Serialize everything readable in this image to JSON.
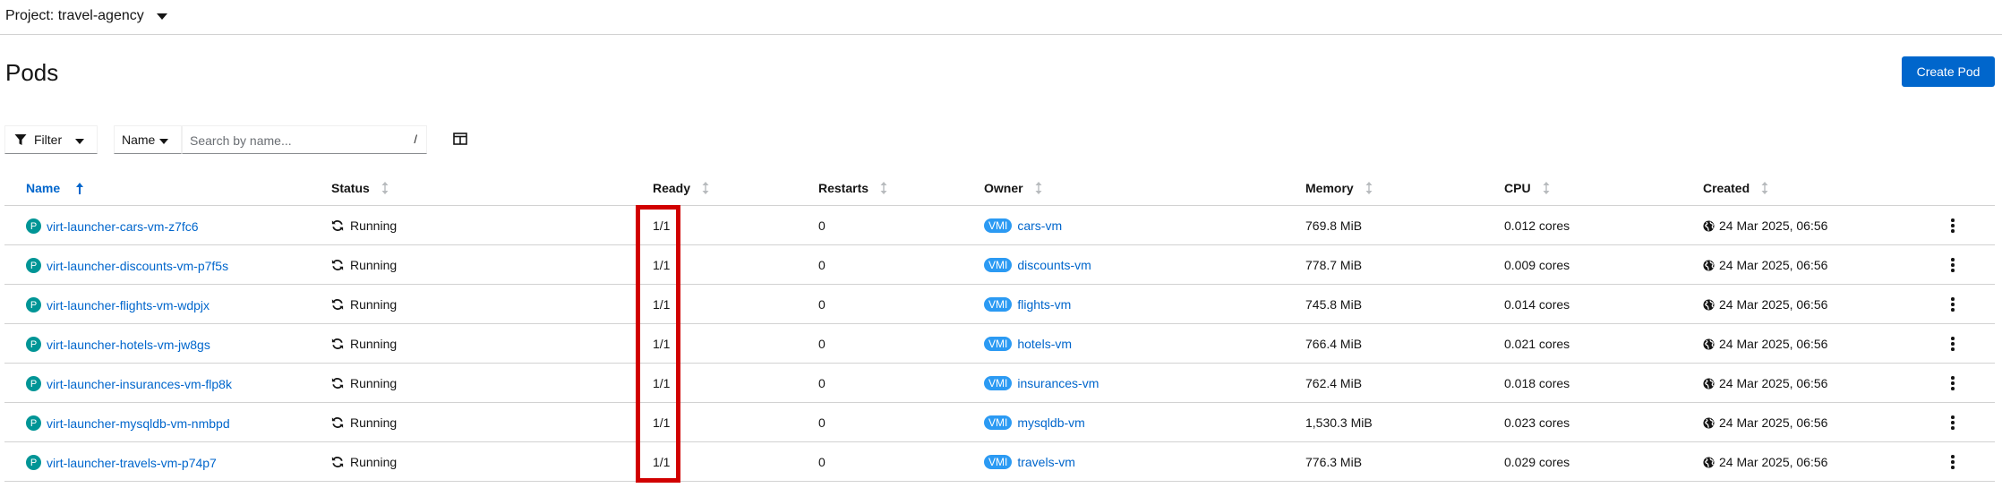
{
  "project": {
    "label": "Project: travel-agency"
  },
  "page": {
    "title": "Pods",
    "create_label": "Create Pod"
  },
  "toolbar": {
    "filter_label": "Filter",
    "name_label": "Name",
    "search_placeholder": "Search by name...",
    "search_hint": "/"
  },
  "table": {
    "headers": {
      "name": "Name",
      "status": "Status",
      "ready": "Ready",
      "restarts": "Restarts",
      "owner": "Owner",
      "memory": "Memory",
      "cpu": "CPU",
      "created": "Created"
    },
    "rows": [
      {
        "badge": "P",
        "name": "virt-launcher-cars-vm-z7fc6",
        "status": "Running",
        "ready": "1/1",
        "restarts": "0",
        "owner_badge": "VMI",
        "owner": "cars-vm",
        "memory": "769.8 MiB",
        "cpu": "0.012 cores",
        "created": "24 Mar 2025, 06:56"
      },
      {
        "badge": "P",
        "name": "virt-launcher-discounts-vm-p7f5s",
        "status": "Running",
        "ready": "1/1",
        "restarts": "0",
        "owner_badge": "VMI",
        "owner": "discounts-vm",
        "memory": "778.7 MiB",
        "cpu": "0.009 cores",
        "created": "24 Mar 2025, 06:56"
      },
      {
        "badge": "P",
        "name": "virt-launcher-flights-vm-wdpjx",
        "status": "Running",
        "ready": "1/1",
        "restarts": "0",
        "owner_badge": "VMI",
        "owner": "flights-vm",
        "memory": "745.8 MiB",
        "cpu": "0.014 cores",
        "created": "24 Mar 2025, 06:56"
      },
      {
        "badge": "P",
        "name": "virt-launcher-hotels-vm-jw8gs",
        "status": "Running",
        "ready": "1/1",
        "restarts": "0",
        "owner_badge": "VMI",
        "owner": "hotels-vm",
        "memory": "766.4 MiB",
        "cpu": "0.021 cores",
        "created": "24 Mar 2025, 06:56"
      },
      {
        "badge": "P",
        "name": "virt-launcher-insurances-vm-flp8k",
        "status": "Running",
        "ready": "1/1",
        "restarts": "0",
        "owner_badge": "VMI",
        "owner": "insurances-vm",
        "memory": "762.4 MiB",
        "cpu": "0.018 cores",
        "created": "24 Mar 2025, 06:56"
      },
      {
        "badge": "P",
        "name": "virt-launcher-mysqldb-vm-nmbpd",
        "status": "Running",
        "ready": "1/1",
        "restarts": "0",
        "owner_badge": "VMI",
        "owner": "mysqldb-vm",
        "memory": "1,530.3 MiB",
        "cpu": "0.023 cores",
        "created": "24 Mar 2025, 06:56"
      },
      {
        "badge": "P",
        "name": "virt-launcher-travels-vm-p74p7",
        "status": "Running",
        "ready": "1/1",
        "restarts": "0",
        "owner_badge": "VMI",
        "owner": "travels-vm",
        "memory": "776.3 MiB",
        "cpu": "0.029 cores",
        "created": "24 Mar 2025, 06:56"
      }
    ]
  },
  "colors": {
    "primary": "#0066cc",
    "pod_badge": "#009596",
    "vmi_badge": "#2b9af3",
    "highlight": "#d10000"
  }
}
